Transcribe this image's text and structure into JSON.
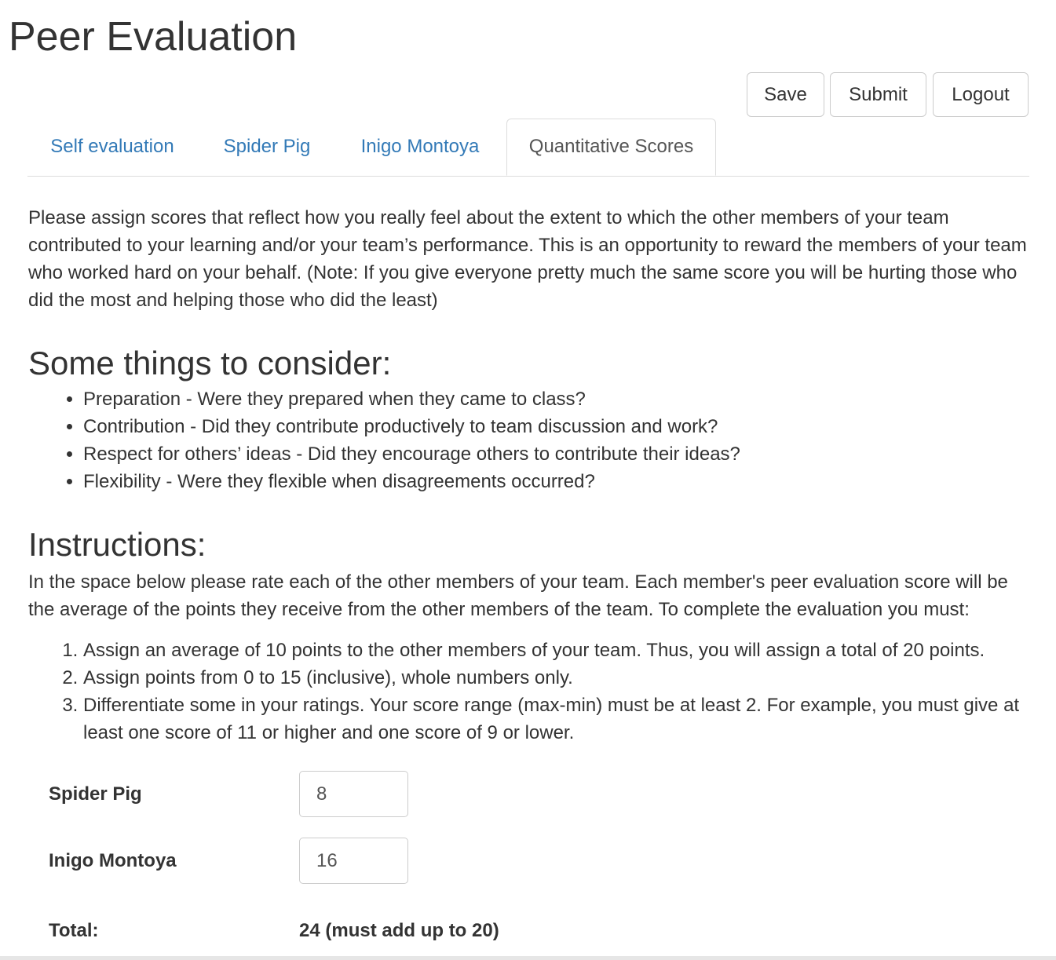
{
  "page": {
    "title": "Peer Evaluation"
  },
  "toolbar": {
    "save_label": "Save",
    "submit_label": "Submit",
    "logout_label": "Logout"
  },
  "tabs": [
    {
      "label": "Self evaluation",
      "active": false
    },
    {
      "label": "Spider Pig",
      "active": false
    },
    {
      "label": "Inigo Montoya",
      "active": false
    },
    {
      "label": "Quantitative Scores",
      "active": true
    }
  ],
  "intro": "Please assign scores that reflect how you really feel about the extent to which the other members of your team contributed to your learning and/or your team’s performance. This is an opportunity to reward the members of your team who worked hard on your behalf. (Note: If you give everyone pretty much the same score you will be hurting those who did the most and helping those who did the least)",
  "consider": {
    "heading": "Some things to consider:",
    "items": [
      "Preparation - Were they prepared when they came to class?",
      "Contribution - Did they contribute productively to team discussion and work?",
      "Respect for others’ ideas - Did they encourage others to contribute their ideas?",
      "Flexibility - Were they flexible when disagreements occurred?"
    ]
  },
  "instructions": {
    "heading": "Instructions:",
    "text": "In the space below please rate each of the other members of your team. Each member's peer evaluation score will be the average of the points they receive from the other members of the team. To complete the evaluation you must:",
    "rules": [
      "Assign an average of 10 points to the other members of your team. Thus, you will assign a total of 20 points.",
      "Assign points from 0 to 15 (inclusive), whole numbers only.",
      "Differentiate some in your ratings. Your score range (max-min) must be at least 2. For example, you must give at least one score of 11 or higher and one score of 9 or lower."
    ]
  },
  "scores": [
    {
      "name": "Spider Pig",
      "value": "8"
    },
    {
      "name": "Inigo Montoya",
      "value": "16"
    }
  ],
  "total": {
    "label": "Total:",
    "value": "24 (must add up to 20)"
  },
  "colors": {
    "link": "#337ab7",
    "text": "#333333",
    "border": "#cccccc"
  }
}
